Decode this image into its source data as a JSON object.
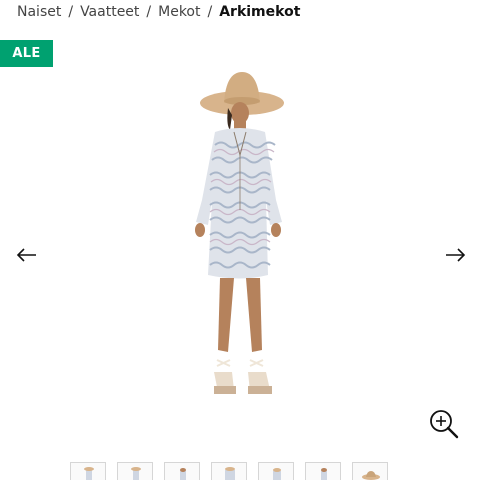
{
  "breadcrumb": {
    "items": [
      "Naiset",
      "Vaatteet",
      "Mekot"
    ],
    "current": "Arkimekot",
    "separator": "/"
  },
  "badge": {
    "label": "ALE",
    "color": "#00a170"
  },
  "gallery": {
    "prev_icon": "arrow-left-icon",
    "next_icon": "arrow-right-icon",
    "zoom_icon": "zoom-in-icon",
    "thumbnail_count": 7
  }
}
